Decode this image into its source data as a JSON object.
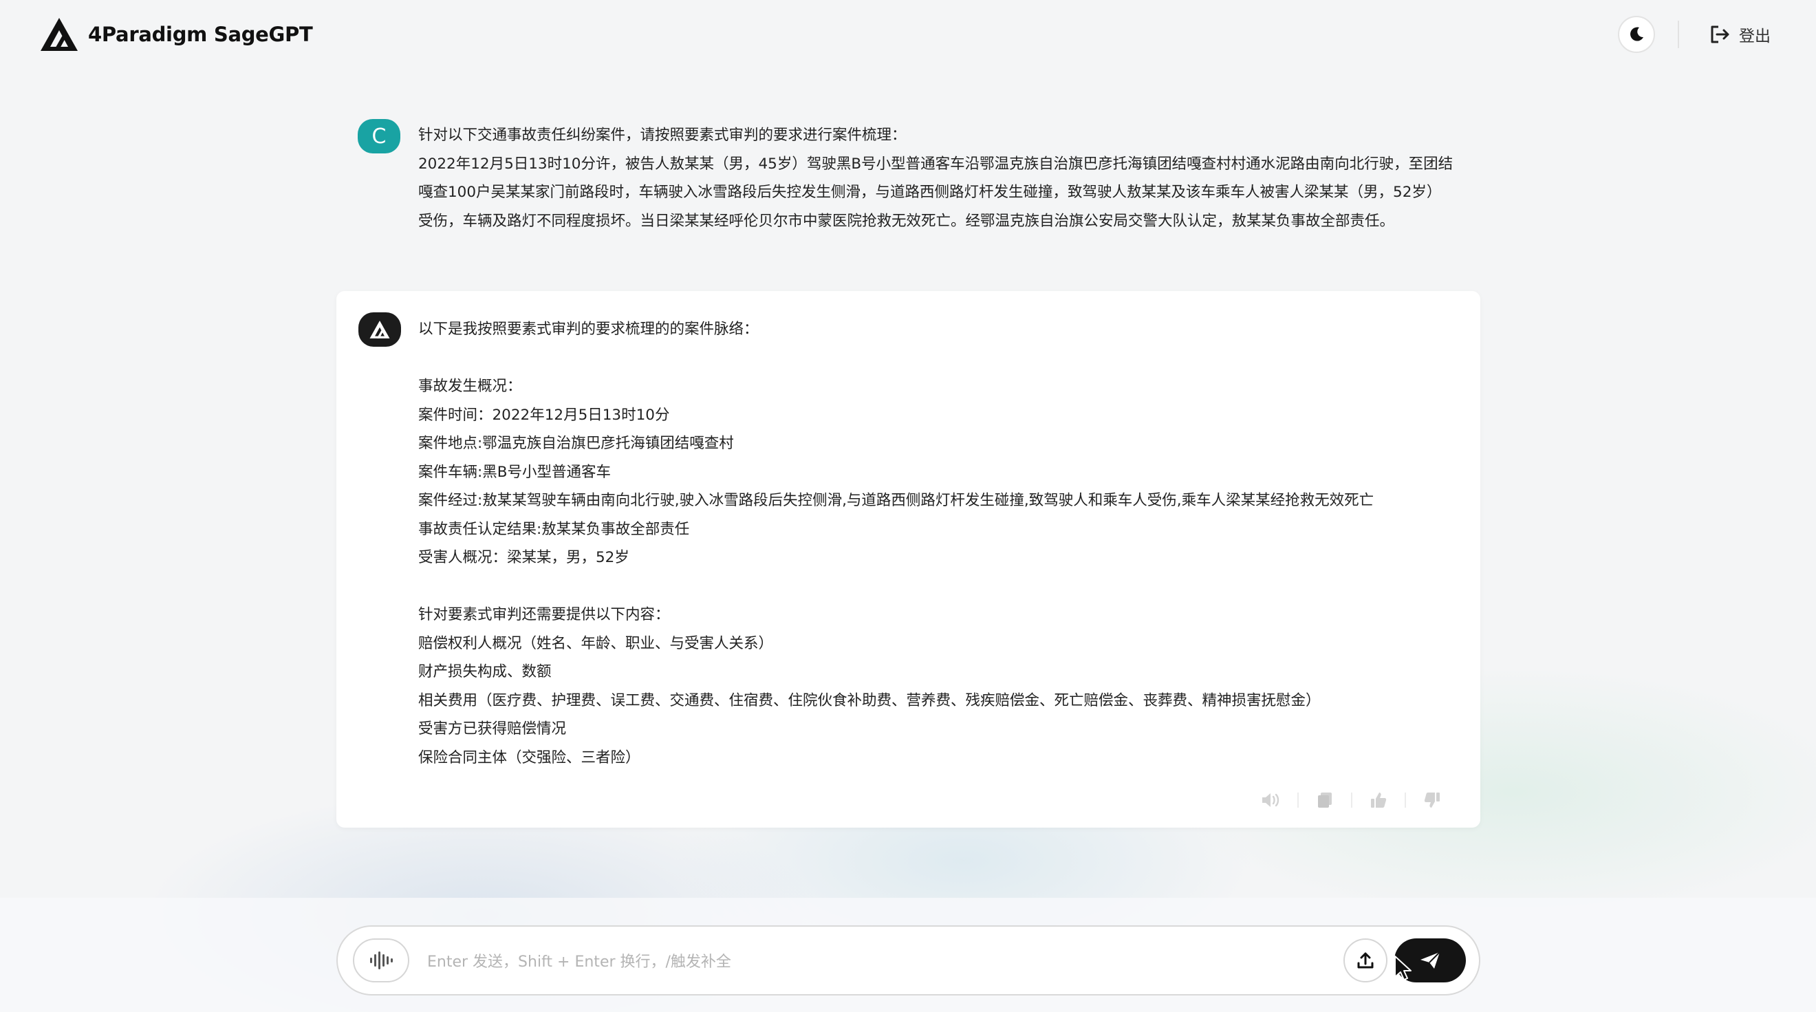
{
  "header": {
    "brand": "4Paradigm SageGPT",
    "logout_label": "登出",
    "theme_toggle_icon": "moon-icon"
  },
  "user_message": {
    "avatar_letter": "C",
    "avatar_color": "#19a3a3",
    "lines": [
      "针对以下交通事故责任纠纷案件，请按照要素式审判的要求进行案件梳理：",
      "2022年12月5日13时10分许，被告人敖某某（男，45岁）驾驶黑B号小型普通客车沿鄂温克族自治旗巴彦托海镇团结嘎查村村通水泥路由南向北行驶，至团结",
      "嘎查100户吴某某家门前路段时，车辆驶入冰雪路段后失控发生侧滑，与道路西侧路灯杆发生碰撞，致驾驶人敖某某及该车乘车人被害人梁某某（男，52岁）",
      "受伤，车辆及路灯不同程度损坏。当日梁某某经呼伦贝尔市中蒙医院抢救无效死亡。经鄂温克族自治旗公安局交警大队认定，敖某某负事故全部责任。"
    ]
  },
  "ai_message": {
    "lines": [
      "以下是我按照要素式审判的要求梳理的的案件脉络：",
      "",
      "事故发生概况：",
      "案件时间：2022年12月5日13时10分",
      "案件地点:鄂温克族自治旗巴彦托海镇团结嘎查村",
      "案件车辆:黑B号小型普通客车",
      "案件经过:敖某某驾驶车辆由南向北行驶,驶入冰雪路段后失控侧滑,与道路西侧路灯杆发生碰撞,致驾驶人和乘车人受伤,乘车人梁某某经抢救无效死亡",
      "事故责任认定结果:敖某某负事故全部责任",
      "受害人概况：梁某某，男，52岁",
      "",
      "针对要素式审判还需要提供以下内容：",
      "赔偿权利人概况（姓名、年龄、职业、与受害人关系）",
      "财产损失构成、数额",
      "相关费用（医疗费、护理费、误工费、交通费、住宿费、住院伙食补助费、营养费、残疾赔偿金、死亡赔偿金、丧葬费、精神损害抚慰金）",
      "受害方已获得赔偿情况",
      "保险合同主体（交强险、三者险）"
    ],
    "actions": [
      "speaker-icon",
      "copy-icon",
      "thumbs-up-icon",
      "thumbs-down-icon"
    ]
  },
  "composer": {
    "placeholder": "Enter 发送，Shift + Enter 换行，/触发补全",
    "value": ""
  }
}
